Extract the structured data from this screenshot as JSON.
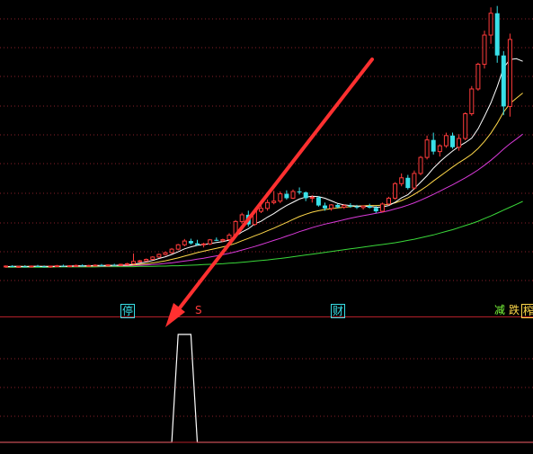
{
  "colors": {
    "background": "#000000",
    "grid": "#8a1f2a",
    "separator": "#b3202a",
    "candle_up": "#ff3b3b",
    "candle_down": "#39e0e8",
    "ma_fast": "#ffffff",
    "ma_mid": "#ffd84a",
    "ma_slow": "#d93ad9",
    "ma_long": "#3ad93a",
    "signal": "#ffffff",
    "arrow": "#ff3030"
  },
  "annotations": {
    "tag_ting": "停",
    "tag_s": "S",
    "tag_cai": "财",
    "tag_jian": "减",
    "tag_die": "跌",
    "tag_zha": "榨"
  },
  "chart_data": [
    {
      "type": "candlestick",
      "title": "",
      "grid": true,
      "ylim": [
        0,
        100
      ],
      "candles": [
        {
          "o": 10.0,
          "h": 10.4,
          "l": 9.6,
          "c": 10.2
        },
        {
          "o": 10.2,
          "h": 10.5,
          "l": 9.8,
          "c": 9.9
        },
        {
          "o": 9.9,
          "h": 10.3,
          "l": 9.6,
          "c": 10.1
        },
        {
          "o": 10.1,
          "h": 10.5,
          "l": 9.8,
          "c": 10.0
        },
        {
          "o": 10.0,
          "h": 10.4,
          "l": 9.7,
          "c": 10.2
        },
        {
          "o": 10.2,
          "h": 10.6,
          "l": 9.9,
          "c": 10.1
        },
        {
          "o": 10.1,
          "h": 10.4,
          "l": 9.7,
          "c": 9.9
        },
        {
          "o": 9.9,
          "h": 10.3,
          "l": 9.6,
          "c": 10.2
        },
        {
          "o": 10.2,
          "h": 10.6,
          "l": 9.9,
          "c": 10.3
        },
        {
          "o": 10.3,
          "h": 10.7,
          "l": 10.0,
          "c": 10.1
        },
        {
          "o": 10.1,
          "h": 10.5,
          "l": 9.8,
          "c": 10.3
        },
        {
          "o": 10.3,
          "h": 10.7,
          "l": 10.0,
          "c": 10.4
        },
        {
          "o": 10.4,
          "h": 10.8,
          "l": 10.1,
          "c": 10.2
        },
        {
          "o": 10.2,
          "h": 10.6,
          "l": 9.9,
          "c": 10.4
        },
        {
          "o": 10.4,
          "h": 10.8,
          "l": 10.1,
          "c": 10.5
        },
        {
          "o": 10.5,
          "h": 10.9,
          "l": 10.2,
          "c": 10.3
        },
        {
          "o": 10.3,
          "h": 10.8,
          "l": 10.0,
          "c": 10.6
        },
        {
          "o": 10.6,
          "h": 11.0,
          "l": 10.3,
          "c": 10.5
        },
        {
          "o": 10.5,
          "h": 11.0,
          "l": 10.2,
          "c": 10.8
        },
        {
          "o": 10.8,
          "h": 11.3,
          "l": 10.5,
          "c": 11.0
        },
        {
          "o": 11.0,
          "h": 14.5,
          "l": 10.8,
          "c": 11.8
        },
        {
          "o": 11.8,
          "h": 12.3,
          "l": 11.4,
          "c": 12.0
        },
        {
          "o": 12.0,
          "h": 12.8,
          "l": 11.7,
          "c": 12.5
        },
        {
          "o": 12.5,
          "h": 13.6,
          "l": 12.2,
          "c": 13.3
        },
        {
          "o": 13.3,
          "h": 14.5,
          "l": 13.0,
          "c": 14.2
        },
        {
          "o": 14.2,
          "h": 15.2,
          "l": 13.8,
          "c": 14.8
        },
        {
          "o": 14.8,
          "h": 16.4,
          "l": 14.4,
          "c": 16.0
        },
        {
          "o": 16.0,
          "h": 17.8,
          "l": 15.6,
          "c": 17.5
        },
        {
          "o": 17.5,
          "h": 19.5,
          "l": 17.0,
          "c": 18.8
        },
        {
          "o": 18.8,
          "h": 19.6,
          "l": 17.6,
          "c": 18.0
        },
        {
          "o": 18.0,
          "h": 19.2,
          "l": 17.2,
          "c": 17.5
        },
        {
          "o": 17.5,
          "h": 18.2,
          "l": 16.6,
          "c": 17.8
        },
        {
          "o": 17.8,
          "h": 19.5,
          "l": 17.4,
          "c": 19.2
        },
        {
          "o": 19.2,
          "h": 20.0,
          "l": 18.8,
          "c": 18.9
        },
        {
          "o": 18.9,
          "h": 19.6,
          "l": 18.4,
          "c": 19.3
        },
        {
          "o": 19.3,
          "h": 21.5,
          "l": 19.0,
          "c": 20.8
        },
        {
          "o": 20.8,
          "h": 26.0,
          "l": 20.5,
          "c": 25.5
        },
        {
          "o": 25.5,
          "h": 28.5,
          "l": 24.8,
          "c": 27.8
        },
        {
          "o": 27.8,
          "h": 29.2,
          "l": 23.8,
          "c": 24.5
        },
        {
          "o": 24.5,
          "h": 29.5,
          "l": 24.0,
          "c": 29.0
        },
        {
          "o": 29.0,
          "h": 32.5,
          "l": 28.4,
          "c": 30.0
        },
        {
          "o": 30.0,
          "h": 33.0,
          "l": 29.2,
          "c": 32.0
        },
        {
          "o": 32.0,
          "h": 36.0,
          "l": 31.4,
          "c": 32.5
        },
        {
          "o": 32.5,
          "h": 35.8,
          "l": 31.8,
          "c": 35.0
        },
        {
          "o": 35.0,
          "h": 36.2,
          "l": 33.0,
          "c": 33.5
        },
        {
          "o": 33.5,
          "h": 36.5,
          "l": 33.2,
          "c": 35.8
        },
        {
          "o": 35.8,
          "h": 37.2,
          "l": 34.8,
          "c": 35.5
        },
        {
          "o": 35.5,
          "h": 35.8,
          "l": 32.5,
          "c": 33.5
        },
        {
          "o": 33.5,
          "h": 34.5,
          "l": 32.0,
          "c": 33.8
        },
        {
          "o": 33.8,
          "h": 34.2,
          "l": 30.6,
          "c": 31.0
        },
        {
          "o": 31.0,
          "h": 32.0,
          "l": 29.2,
          "c": 30.0
        },
        {
          "o": 30.0,
          "h": 31.5,
          "l": 29.2,
          "c": 31.2
        },
        {
          "o": 31.2,
          "h": 31.6,
          "l": 30.0,
          "c": 30.4
        },
        {
          "o": 30.4,
          "h": 31.4,
          "l": 29.8,
          "c": 31.0
        },
        {
          "o": 31.0,
          "h": 31.8,
          "l": 30.2,
          "c": 30.6
        },
        {
          "o": 30.6,
          "h": 31.2,
          "l": 29.8,
          "c": 30.3
        },
        {
          "o": 30.3,
          "h": 31.0,
          "l": 29.6,
          "c": 30.8
        },
        {
          "o": 30.8,
          "h": 31.6,
          "l": 30.0,
          "c": 30.2
        },
        {
          "o": 30.2,
          "h": 30.8,
          "l": 28.4,
          "c": 29.0
        },
        {
          "o": 29.0,
          "h": 32.0,
          "l": 28.6,
          "c": 31.5
        },
        {
          "o": 31.5,
          "h": 34.0,
          "l": 31.0,
          "c": 33.5
        },
        {
          "o": 33.5,
          "h": 39.0,
          "l": 33.0,
          "c": 38.5
        },
        {
          "o": 38.5,
          "h": 42.0,
          "l": 37.6,
          "c": 40.5
        },
        {
          "o": 40.5,
          "h": 41.5,
          "l": 36.5,
          "c": 37.0
        },
        {
          "o": 37.0,
          "h": 43.0,
          "l": 36.4,
          "c": 42.0
        },
        {
          "o": 42.0,
          "h": 48.0,
          "l": 41.4,
          "c": 47.5
        },
        {
          "o": 47.5,
          "h": 55.0,
          "l": 46.8,
          "c": 53.5
        },
        {
          "o": 53.5,
          "h": 56.0,
          "l": 48.5,
          "c": 49.5
        },
        {
          "o": 49.5,
          "h": 52.0,
          "l": 47.8,
          "c": 51.5
        },
        {
          "o": 51.5,
          "h": 56.0,
          "l": 50.8,
          "c": 55.0
        },
        {
          "o": 55.0,
          "h": 56.0,
          "l": 50.5,
          "c": 51.0
        },
        {
          "o": 51.0,
          "h": 55.5,
          "l": 49.8,
          "c": 54.0
        },
        {
          "o": 54.0,
          "h": 63.0,
          "l": 53.4,
          "c": 62.5
        },
        {
          "o": 62.5,
          "h": 72.0,
          "l": 61.8,
          "c": 71.0
        },
        {
          "o": 71.0,
          "h": 80.0,
          "l": 70.4,
          "c": 79.5
        },
        {
          "o": 79.5,
          "h": 91.0,
          "l": 78.0,
          "c": 89.5
        },
        {
          "o": 89.5,
          "h": 99.0,
          "l": 86.5,
          "c": 97.0
        },
        {
          "o": 97.0,
          "h": 99.5,
          "l": 80.0,
          "c": 82.5
        },
        {
          "o": 82.5,
          "h": 84.0,
          "l": 62.0,
          "c": 65.0
        },
        {
          "o": 65.0,
          "h": 90.0,
          "l": 61.5,
          "c": 88.0
        }
      ],
      "ma_fast": [
        10.0,
        10.1,
        10.1,
        10.0,
        10.1,
        10.1,
        10.0,
        10.0,
        10.1,
        10.1,
        10.2,
        10.3,
        10.3,
        10.3,
        10.4,
        10.4,
        10.4,
        10.5,
        10.5,
        10.6,
        10.9,
        11.2,
        11.6,
        12.1,
        12.8,
        13.4,
        14.2,
        15.1,
        16.1,
        16.8,
        17.3,
        17.6,
        17.9,
        18.3,
        18.6,
        19.1,
        20.4,
        21.9,
        23.0,
        24.7,
        25.6,
        27.0,
        28.2,
        29.7,
        31.0,
        32.1,
        33.2,
        33.9,
        34.2,
        34.0,
        33.5,
        32.6,
        31.7,
        31.2,
        31.0,
        30.8,
        30.7,
        30.7,
        30.4,
        30.5,
        31.0,
        32.1,
        33.6,
        34.7,
        36.8,
        39.0,
        41.2,
        43.8,
        46.0,
        47.9,
        49.7,
        51.3,
        52.6,
        54.1,
        57.3,
        61.6,
        66.2,
        71.8,
        78.3,
        81.1,
        81.4,
        80.5
      ],
      "ma_mid": [
        10.0,
        10.0,
        10.1,
        10.1,
        10.1,
        10.1,
        10.1,
        10.1,
        10.1,
        10.1,
        10.1,
        10.2,
        10.2,
        10.2,
        10.3,
        10.3,
        10.3,
        10.4,
        10.4,
        10.5,
        10.6,
        10.8,
        11.0,
        11.3,
        11.6,
        12.0,
        12.5,
        13.0,
        13.6,
        14.2,
        14.8,
        15.3,
        15.8,
        16.3,
        16.8,
        17.3,
        18.0,
        18.9,
        19.7,
        20.6,
        21.4,
        22.3,
        23.2,
        24.2,
        25.2,
        26.2,
        27.2,
        28.0,
        28.7,
        29.2,
        29.6,
        29.9,
        30.2,
        30.4,
        30.6,
        30.8,
        30.9,
        31.0,
        31.0,
        31.1,
        31.4,
        31.9,
        32.7,
        33.6,
        34.8,
        36.2,
        37.7,
        39.4,
        41.0,
        42.6,
        44.2,
        45.7,
        47.1,
        48.6,
        50.6,
        53.0,
        55.8,
        59.2,
        63.1,
        66.0,
        67.8,
        69.6
      ],
      "ma_slow": [
        10.0,
        10.0,
        10.0,
        10.0,
        10.0,
        10.1,
        10.1,
        10.1,
        10.1,
        10.1,
        10.1,
        10.1,
        10.1,
        10.2,
        10.2,
        10.2,
        10.2,
        10.3,
        10.3,
        10.3,
        10.4,
        10.5,
        10.6,
        10.7,
        10.9,
        11.1,
        11.3,
        11.6,
        11.9,
        12.2,
        12.6,
        12.9,
        13.3,
        13.7,
        14.1,
        14.6,
        15.1,
        15.7,
        16.3,
        16.9,
        17.6,
        18.3,
        19.0,
        19.7,
        20.5,
        21.2,
        22.0,
        22.7,
        23.4,
        24.0,
        24.6,
        25.1,
        25.6,
        26.1,
        26.6,
        27.1,
        27.5,
        27.9,
        28.3,
        28.7,
        29.2,
        29.8,
        30.4,
        31.1,
        31.9,
        32.8,
        33.8,
        34.8,
        35.9,
        37.0,
        38.1,
        39.3,
        40.5,
        41.8,
        43.2,
        44.8,
        46.5,
        48.4,
        50.4,
        52.2,
        53.8,
        55.5
      ],
      "ma_long": [
        9.8,
        9.8,
        9.8,
        9.8,
        9.8,
        9.8,
        9.8,
        9.8,
        9.9,
        9.9,
        9.9,
        9.9,
        9.9,
        9.9,
        9.9,
        10.0,
        10.0,
        10.0,
        10.0,
        10.0,
        10.0,
        10.1,
        10.1,
        10.1,
        10.2,
        10.2,
        10.3,
        10.3,
        10.4,
        10.5,
        10.6,
        10.7,
        10.8,
        10.9,
        11.0,
        11.2,
        11.3,
        11.5,
        11.7,
        11.9,
        12.1,
        12.3,
        12.6,
        12.8,
        13.1,
        13.4,
        13.7,
        14.0,
        14.3,
        14.6,
        14.9,
        15.2,
        15.5,
        15.8,
        16.1,
        16.4,
        16.7,
        17.0,
        17.3,
        17.6,
        17.9,
        18.2,
        18.6,
        19.0,
        19.4,
        19.9,
        20.4,
        20.9,
        21.5,
        22.1,
        22.7,
        23.4,
        24.1,
        24.8,
        25.6,
        26.5,
        27.4,
        28.4,
        29.4,
        30.4,
        31.4,
        32.4
      ]
    },
    {
      "type": "line",
      "title": "",
      "grid": true,
      "ylim": [
        0,
        1
      ],
      "values": [
        0,
        0,
        0,
        0,
        0,
        0,
        0,
        0,
        0,
        0,
        0,
        0,
        0,
        0,
        0,
        0,
        0,
        0,
        0,
        0,
        0,
        0,
        0,
        0,
        0,
        0,
        0,
        1,
        1,
        1,
        0,
        0,
        0,
        0,
        0,
        0,
        0,
        0,
        0,
        0,
        0,
        0,
        0,
        0,
        0,
        0,
        0,
        0,
        0,
        0,
        0,
        0,
        0,
        0,
        0,
        0,
        0,
        0,
        0,
        0,
        0,
        0,
        0,
        0,
        0,
        0,
        0,
        0,
        0,
        0,
        0,
        0,
        0,
        0,
        0,
        0,
        0,
        0,
        0,
        0,
        0,
        0
      ]
    }
  ]
}
